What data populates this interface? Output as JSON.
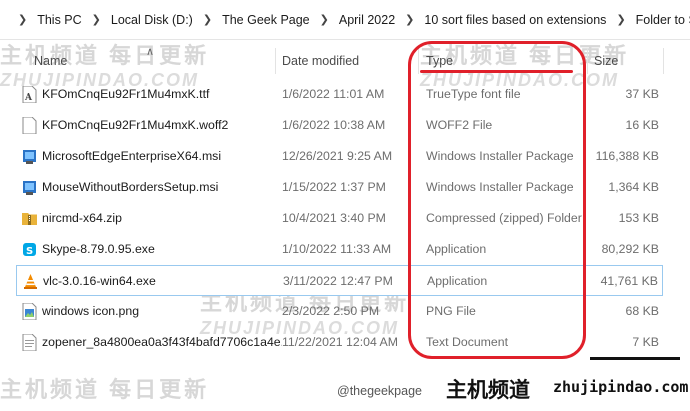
{
  "breadcrumb": [
    "This PC",
    "Local Disk (D:)",
    "The Geek Page",
    "April 2022",
    "10 sort files based on extensions",
    "Folder to Sort"
  ],
  "columns": {
    "name": "Name",
    "date": "Date modified",
    "type": "Type",
    "size": "Size"
  },
  "files": [
    {
      "name": "KFOmCnqEu92Fr1Mu4mxK.ttf",
      "date": "1/6/2022 11:01 AM",
      "type": "TrueType font file",
      "size": "37 KB",
      "icon": "font-file-icon"
    },
    {
      "name": "KFOmCnqEu92Fr1Mu4mxK.woff2",
      "date": "1/6/2022 10:38 AM",
      "type": "WOFF2 File",
      "size": "16 KB",
      "icon": "blank-file-icon"
    },
    {
      "name": "MicrosoftEdgeEnterpriseX64.msi",
      "date": "12/26/2021 9:25 AM",
      "type": "Windows Installer Package",
      "size": "116,388 KB",
      "icon": "installer-icon"
    },
    {
      "name": "MouseWithoutBordersSetup.msi",
      "date": "1/15/2022 1:37 PM",
      "type": "Windows Installer Package",
      "size": "1,364 KB",
      "icon": "installer-icon"
    },
    {
      "name": "nircmd-x64.zip",
      "date": "10/4/2021 3:40 PM",
      "type": "Compressed (zipped) Folder",
      "size": "153 KB",
      "icon": "zip-folder-icon"
    },
    {
      "name": "Skype-8.79.0.95.exe",
      "date": "1/10/2022 11:33 AM",
      "type": "Application",
      "size": "80,292 KB",
      "icon": "skype-app-icon"
    },
    {
      "name": "vlc-3.0.16-win64.exe",
      "date": "3/11/2022 12:47 PM",
      "type": "Application",
      "size": "41,761 KB",
      "icon": "vlc-cone-icon"
    },
    {
      "name": "windows icon.png",
      "date": "2/3/2022 2:50 PM",
      "type": "PNG File",
      "size": "68 KB",
      "icon": "image-file-icon"
    },
    {
      "name": "zopener_8a4800ea0a3f43f4bafd7706c1a4e...",
      "date": "11/22/2021 12:04 AM",
      "type": "Text Document",
      "size": "7 KB",
      "icon": "text-file-icon"
    }
  ],
  "watermark": {
    "cn": "主机频道 每日更新",
    "en": "ZHUJIPINDAO.COM"
  },
  "footer": {
    "cn": "主机频道",
    "en": "zhujipindao.com",
    "credit": "@thegeekpage"
  },
  "colors": {
    "annotation": "#e0202a",
    "selection_border": "#99c9ef"
  }
}
